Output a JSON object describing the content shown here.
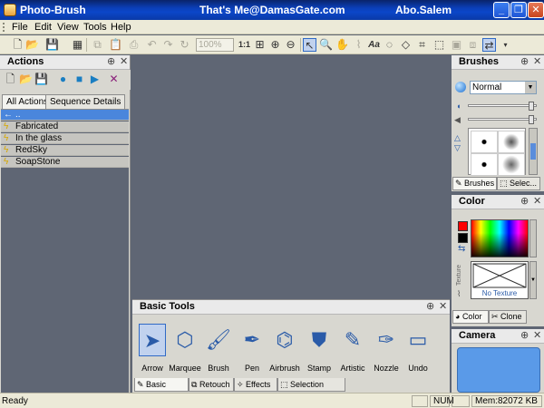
{
  "window": {
    "app_title": "Photo-Brush",
    "center_text": "That's Me@DamasGate.com",
    "right_text": "Abo.Salem",
    "min": "_",
    "max": "❐",
    "close": "✕"
  },
  "menu": {
    "items": [
      "File",
      "Edit",
      "View",
      "Tools",
      "Help"
    ]
  },
  "toolbar": {
    "zoom_value": "100%",
    "one_to_one": "1:1"
  },
  "actions_panel": {
    "title": "Actions",
    "pin": "⊕",
    "close": "✕",
    "tabs": [
      "All Actions",
      "Sequence Details"
    ],
    "items": [
      {
        "label": "..",
        "selected": true,
        "icon": "arrow-left-icon"
      },
      {
        "label": "Fabricated",
        "selected": false,
        "icon": "bolt-icon"
      },
      {
        "label": "In the glass",
        "selected": false,
        "icon": "bolt-icon"
      },
      {
        "label": "RedSky",
        "selected": false,
        "icon": "bolt-icon"
      },
      {
        "label": "SoapStone",
        "selected": false,
        "icon": "bolt-icon"
      }
    ]
  },
  "basic_tools": {
    "title": "Basic Tools",
    "pin": "⊕",
    "close": "✕",
    "tools": [
      {
        "label": "Arrow",
        "icon": "arrow-tool-icon",
        "selected": true
      },
      {
        "label": "Marquee",
        "icon": "marquee-tool-icon"
      },
      {
        "label": "Brush",
        "icon": "brush-tool-icon"
      },
      {
        "label": "Pen",
        "icon": "pen-tool-icon"
      },
      {
        "label": "Airbrush",
        "icon": "airbrush-tool-icon"
      },
      {
        "label": "Stamp",
        "icon": "stamp-tool-icon"
      },
      {
        "label": "Artistic",
        "icon": "artistic-tool-icon"
      },
      {
        "label": "Nozzle",
        "icon": "nozzle-tool-icon"
      },
      {
        "label": "Undo",
        "icon": "undo-tool-icon"
      }
    ],
    "tabs": [
      "Basic Tools",
      "Retouch",
      "Effects",
      "Selection Tools"
    ]
  },
  "brushes_panel": {
    "title": "Brushes",
    "pin": "⊕",
    "close": "✕",
    "blend_mode": "Normal",
    "tabs": [
      "Brushes",
      "Selec..."
    ]
  },
  "color_panel": {
    "title": "Color",
    "pin": "⊕",
    "close": "✕",
    "texture_label": "No Texture",
    "side_label": "Texture",
    "tabs": [
      "Color",
      "Clone"
    ],
    "fg_color": "#ff0000",
    "bg_color": "#000000"
  },
  "camera_panel": {
    "title": "Camera",
    "pin": "⊕",
    "close": "✕"
  },
  "status": {
    "text": "Ready",
    "num": "NUM",
    "memory": "Mem:82072 KB"
  }
}
